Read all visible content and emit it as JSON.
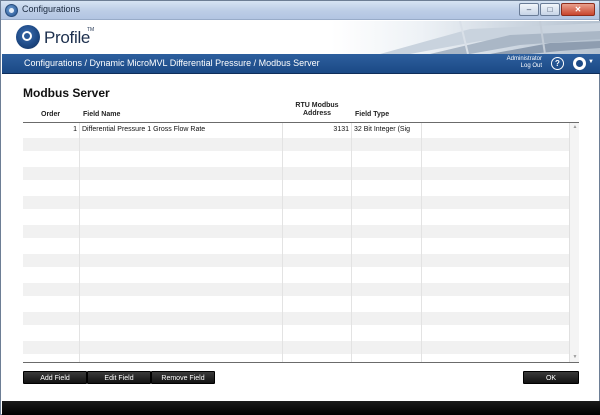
{
  "window": {
    "title": "Configurations",
    "minimize": "–",
    "maximize": "□",
    "close": "✕"
  },
  "header": {
    "logo_text": "Profile",
    "logo_tm": "TM"
  },
  "navbar": {
    "breadcrumb": "Configurations / Dynamic MicroMVL Differential Pressure / Modbus Server",
    "user": "Administrator",
    "logout": "Log Out",
    "help": "?",
    "menu_caret": "▼"
  },
  "page": {
    "title": "Modbus Server"
  },
  "grid": {
    "columns": {
      "order": "Order",
      "field_name": "Field Name",
      "rtu_line1": "RTU Modbus",
      "rtu_line2": "Address",
      "field_type": "Field Type"
    },
    "rows": [
      {
        "order": "1",
        "field_name": "Differential Pressure 1 Gross Flow Rate",
        "rtu_address": "3131",
        "field_type": "32 Bit Integer (Sig"
      }
    ],
    "scroll_up": "▲",
    "scroll_down": "▼"
  },
  "buttons": {
    "add_field": "Add Field",
    "edit_field": "Edit Field",
    "remove_field": "Remove Field",
    "ok": "OK"
  },
  "colors": {
    "navbar": "#1f4f8d",
    "button": "#1a1a1a",
    "row_alt": "#f1f1f1"
  }
}
